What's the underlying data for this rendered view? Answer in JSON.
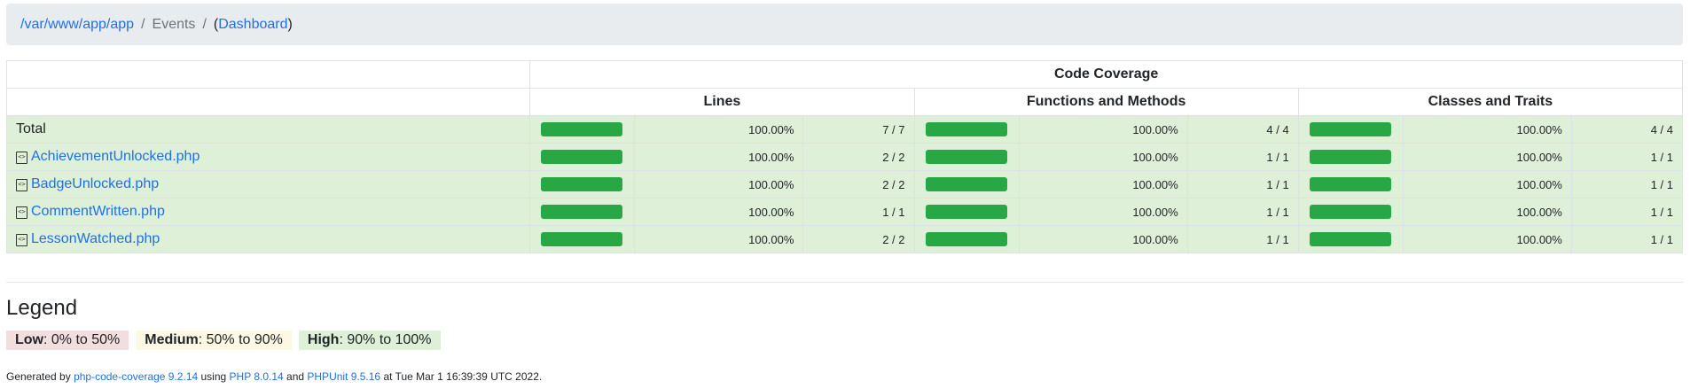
{
  "breadcrumb": {
    "path_link": "/var/www/app/app",
    "separator": "/",
    "current": "Events",
    "dashboard_open": "(",
    "dashboard_link": "Dashboard",
    "dashboard_close": ")"
  },
  "table": {
    "header_group": "Code Coverage",
    "col_lines": "Lines",
    "col_functions": "Functions and Methods",
    "col_classes": "Classes and Traits",
    "rows": [
      {
        "name": "Total",
        "lines_pct": "100.00%",
        "lines_frac": "7 / 7",
        "func_pct": "100.00%",
        "func_frac": "4 / 4",
        "class_pct": "100.00%",
        "class_frac": "4 / 4",
        "lines_level": 1.0,
        "func_level": 1.0,
        "class_level": 1.0
      },
      {
        "name": "AchievementUnlocked.php",
        "lines_pct": "100.00%",
        "lines_frac": "2 / 2",
        "func_pct": "100.00%",
        "func_frac": "1 / 1",
        "class_pct": "100.00%",
        "class_frac": "1 / 1",
        "lines_level": 1.0,
        "func_level": 1.0,
        "class_level": 1.0
      },
      {
        "name": "BadgeUnlocked.php",
        "lines_pct": "100.00%",
        "lines_frac": "2 / 2",
        "func_pct": "100.00%",
        "func_frac": "1 / 1",
        "class_pct": "100.00%",
        "class_frac": "1 / 1",
        "lines_level": 1.0,
        "func_level": 1.0,
        "class_level": 1.0
      },
      {
        "name": "CommentWritten.php",
        "lines_pct": "100.00%",
        "lines_frac": "1 / 1",
        "func_pct": "100.00%",
        "func_frac": "1 / 1",
        "class_pct": "100.00%",
        "class_frac": "1 / 1",
        "lines_level": 1.0,
        "func_level": 1.0,
        "class_level": 1.0
      },
      {
        "name": "LessonWatched.php",
        "lines_pct": "100.00%",
        "lines_frac": "2 / 2",
        "func_pct": "100.00%",
        "func_frac": "1 / 1",
        "class_pct": "100.00%",
        "class_frac": "1 / 1",
        "lines_level": 1.0,
        "func_level": 1.0,
        "class_level": 1.0
      }
    ]
  },
  "legend": {
    "title": "Legend",
    "low_label": "Low",
    "low_range": ": 0% to 50%",
    "medium_label": "Medium",
    "medium_range": ": 50% to 90%",
    "high_label": "High",
    "high_range": ": 90% to 100%"
  },
  "footer": {
    "generated_by": "Generated by ",
    "tool_link": "php-code-coverage 9.2.14",
    "using": " using ",
    "php_link": "PHP 8.0.14",
    "and": " and ",
    "phpunit_link": "PHPUnit 9.5.16",
    "at": " at Tue Mar 1 16:39:39 UTC 2022."
  },
  "colors": {
    "success_row": "#dff0d8",
    "bar_fill": "#28a745",
    "link": "#1f6feb",
    "low": "#f2dede",
    "medium": "#fcf8e3",
    "high": "#dff0d8"
  },
  "icons": {
    "file": "code-file-icon"
  }
}
